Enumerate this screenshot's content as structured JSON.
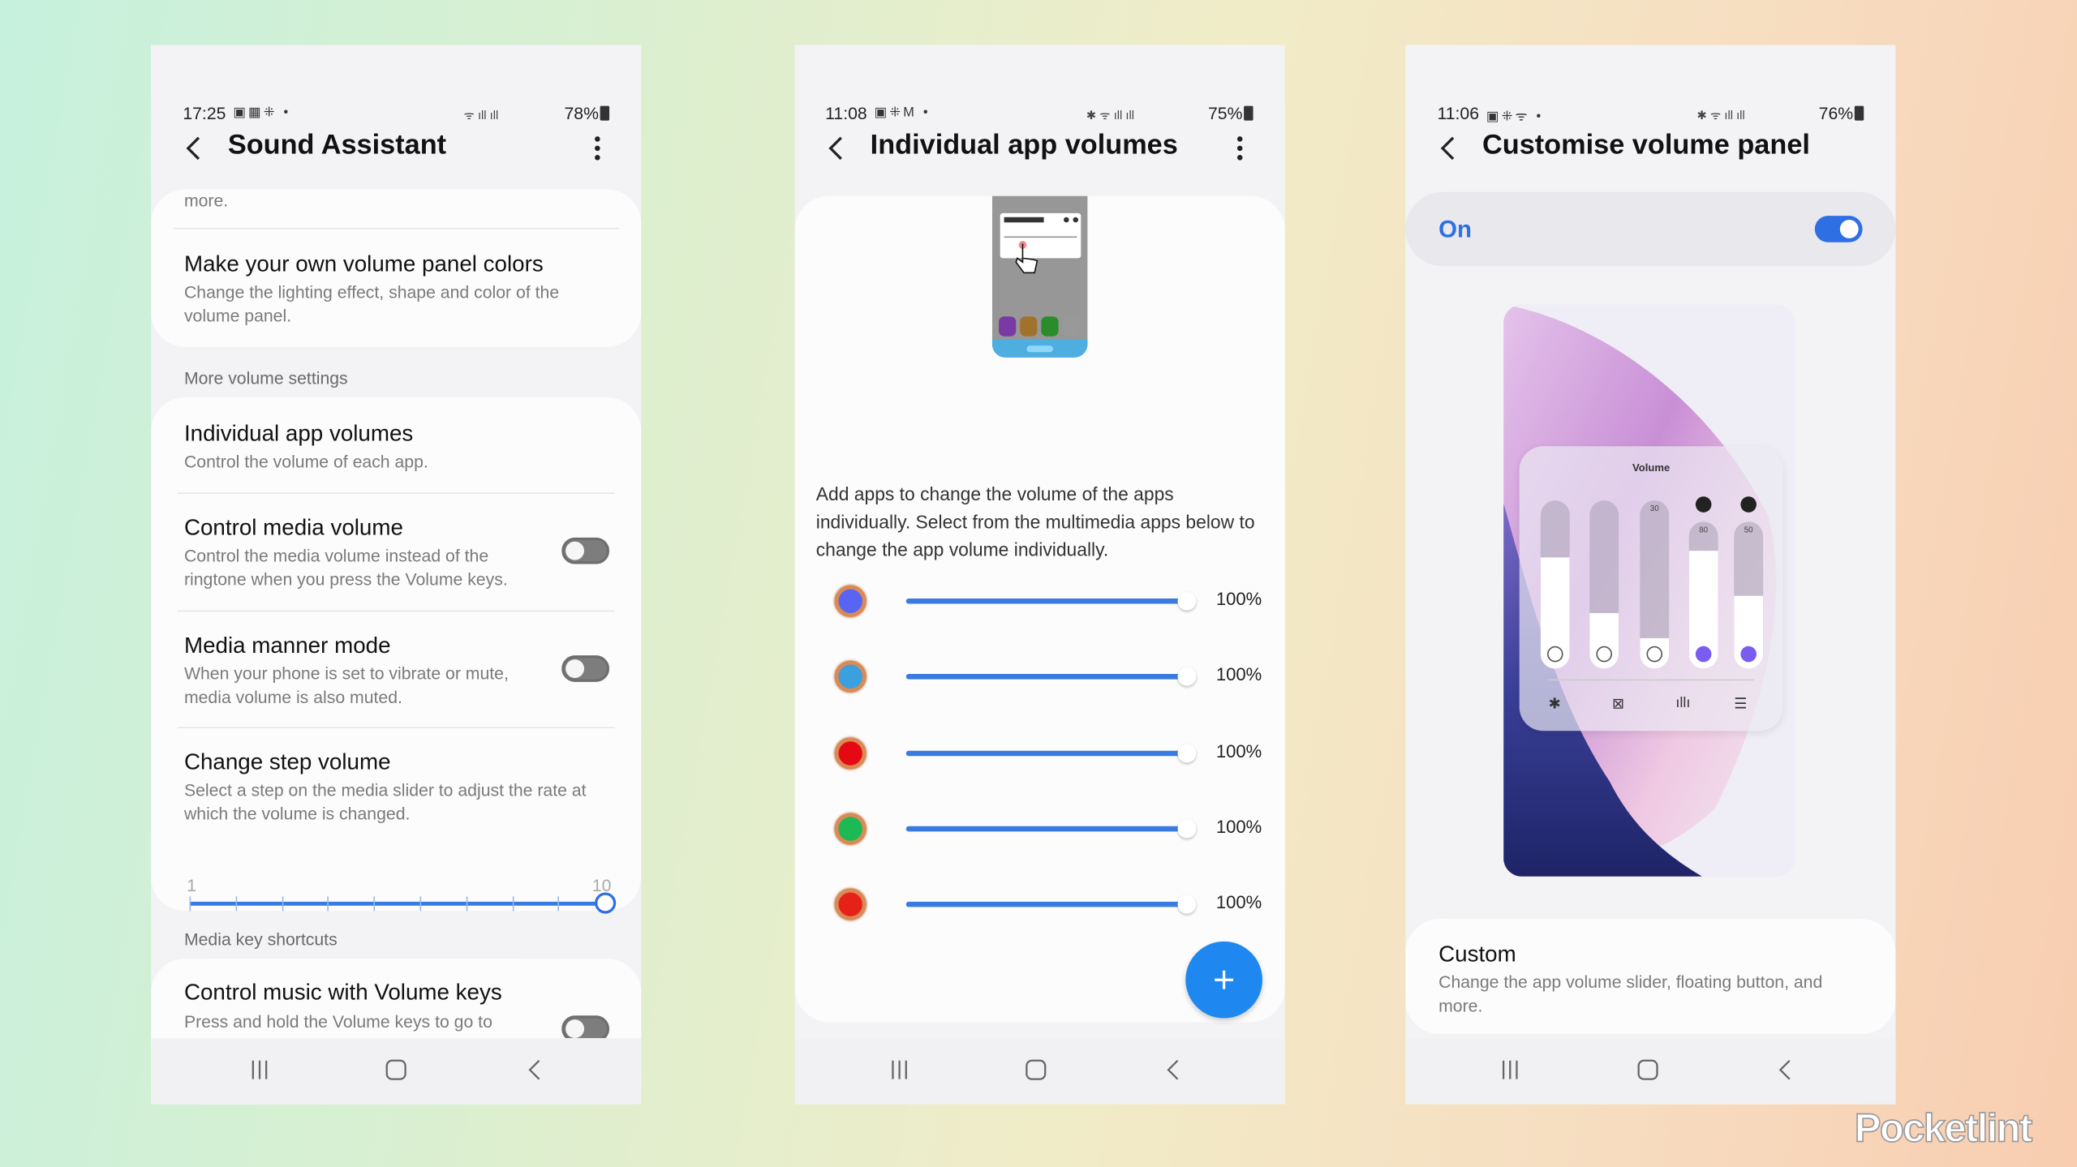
{
  "screen1": {
    "status": {
      "time": "17:25",
      "battery": "78%"
    },
    "title": "Sound Assistant",
    "truncated_text": "more.",
    "items": [
      {
        "title": "Make your own volume panel colors",
        "desc": "Change the lighting effect, shape and color of the volume panel."
      },
      {
        "title": "Individual app volumes",
        "desc": "Control the volume of each app."
      },
      {
        "title": "Control media volume",
        "desc": "Control the media volume instead of the ringtone when you press the Volume keys.",
        "toggle": false
      },
      {
        "title": "Media manner mode",
        "desc": "When your phone is set to vibrate or mute, media volume is also muted.",
        "toggle": false
      },
      {
        "title": "Change step volume",
        "desc": "Select a step on the media slider to adjust the rate at which the volume is changed."
      },
      {
        "title": "Control music with Volume keys",
        "desc": "Press and hold the Volume keys to go to",
        "toggle": false
      }
    ],
    "sections": [
      "More volume settings",
      "Media key shortcuts"
    ],
    "step_slider": {
      "min": "1",
      "max": "10",
      "value": 10
    }
  },
  "screen2": {
    "status": {
      "time": "11:08",
      "battery": "75%"
    },
    "title": "Individual app volumes",
    "description": "Add apps to change the volume of the apps individually. Select from the multimedia apps below to change the app volume individually.",
    "apps": [
      {
        "icon": "discord-icon",
        "color": "#5865f2",
        "value": 100,
        "label": "100%"
      },
      {
        "icon": "mickey-game-icon",
        "color": "#3aa0e0",
        "value": 100,
        "label": "100%"
      },
      {
        "icon": "netflix-icon",
        "color": "#e50914",
        "value": 100,
        "label": "100%"
      },
      {
        "icon": "spotify-icon",
        "color": "#1db954",
        "value": 100,
        "label": "100%"
      },
      {
        "icon": "youtube-music-icon",
        "color": "#e62117",
        "value": 100,
        "label": "100%"
      }
    ],
    "fab_icon": "plus-icon",
    "accent": "#1e88f0"
  },
  "screen3": {
    "status": {
      "time": "11:06",
      "battery": "76%"
    },
    "title": "Customise volume panel",
    "master_label": "On",
    "master_toggle": true,
    "preview": {
      "title": "Volume",
      "sliders": [
        {
          "icon": "bell-icon",
          "level": 0.66,
          "label": ""
        },
        {
          "icon": "speaker-icon",
          "level": 0.33,
          "label": ""
        },
        {
          "icon": "music-note-icon",
          "level": 0.18,
          "label": "30"
        },
        {
          "icon": "app-equalizer-icon",
          "level": 0.8,
          "label": "80"
        },
        {
          "icon": "app-equalizer-icon",
          "level": 0.5,
          "label": "50"
        }
      ],
      "bottom_icons": [
        "bluetooth-icon",
        "cast-off-icon",
        "equalizer-icon",
        "settings-sliders-icon"
      ]
    },
    "custom": {
      "title": "Custom",
      "desc": "Change the app volume slider, floating button, and more."
    },
    "accent": "#2f6fe4"
  },
  "watermark": "Pocketlint"
}
